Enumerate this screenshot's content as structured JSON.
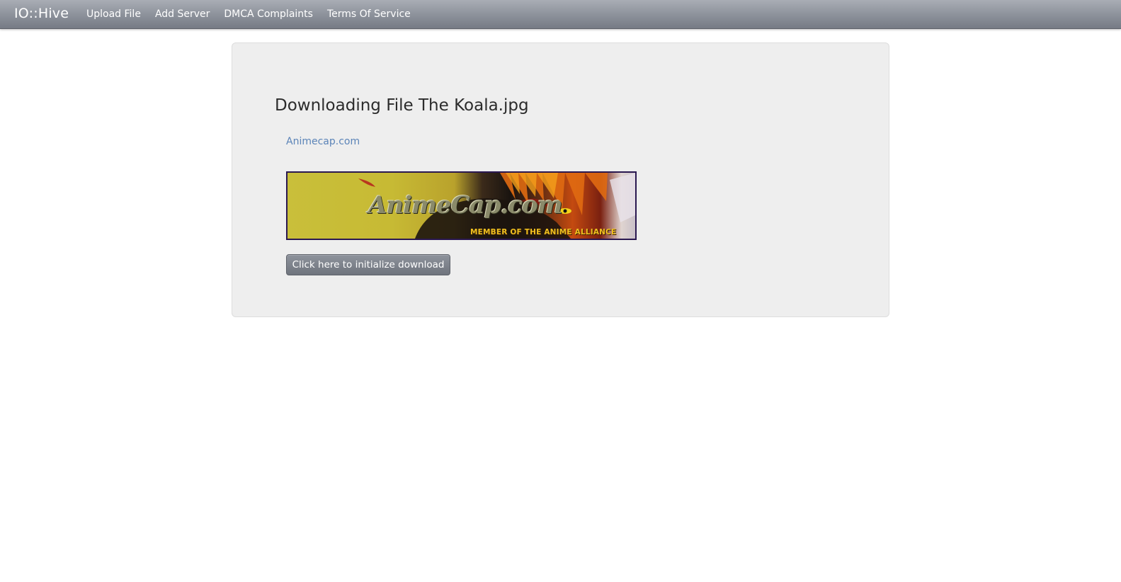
{
  "navbar": {
    "brand": "IO::Hive",
    "links": [
      {
        "label": "Upload File"
      },
      {
        "label": "Add Server"
      },
      {
        "label": "DMCA Complaints"
      },
      {
        "label": "Terms Of Service"
      }
    ]
  },
  "main": {
    "title": "Downloading File The Koala.jpg",
    "sponsor_link": "Animecap.com",
    "banner": {
      "logo_text": "AnimeCap.com",
      "tagline": "MEMBER OF THE ANIME ALLIANCE"
    },
    "download_button_label": "Click here to initialize download"
  }
}
